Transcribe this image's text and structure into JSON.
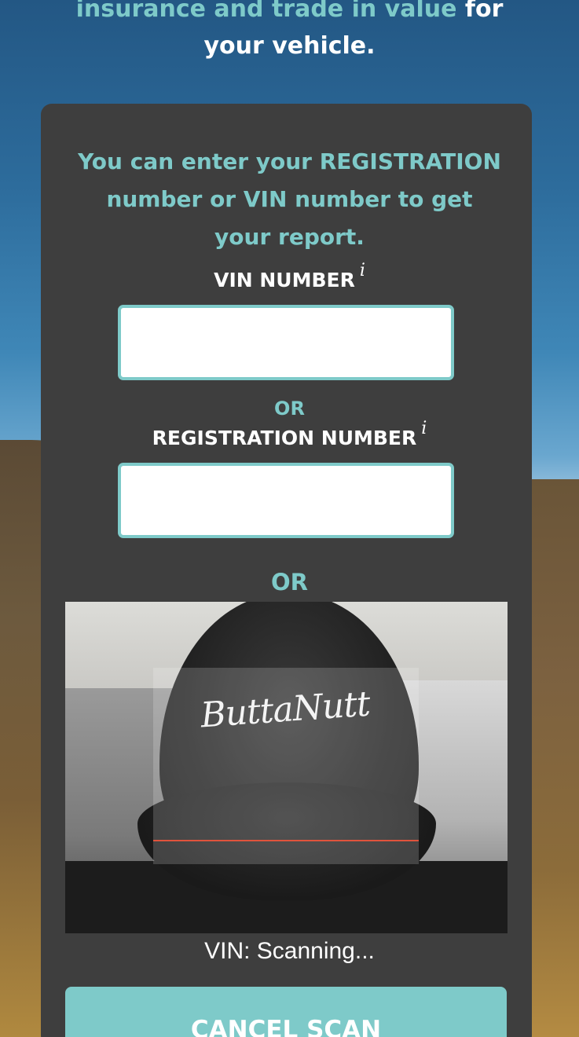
{
  "hero": {
    "line1_accent": "insurance and trade in value",
    "line1_plain": "for",
    "line2": "your vehicle."
  },
  "form": {
    "intro": "You can enter your REGISTRATION number or VIN number to get your report.",
    "vin_label": "VIN NUMBER",
    "info_glyph": "i",
    "vin_value": "",
    "or_small": "OR",
    "reg_label": "REGISTRATION NUMBER",
    "reg_value": "",
    "or_large": "OR"
  },
  "scanner": {
    "logo_text": "ButtaNutt",
    "status": "VIN: Scanning...",
    "cancel_label": "CANCEL SCAN"
  },
  "colors": {
    "accent": "#7ecac9",
    "panel": "#3e3e3e",
    "scan_line": "#e0533c"
  },
  "icons": [
    "info-icon"
  ]
}
